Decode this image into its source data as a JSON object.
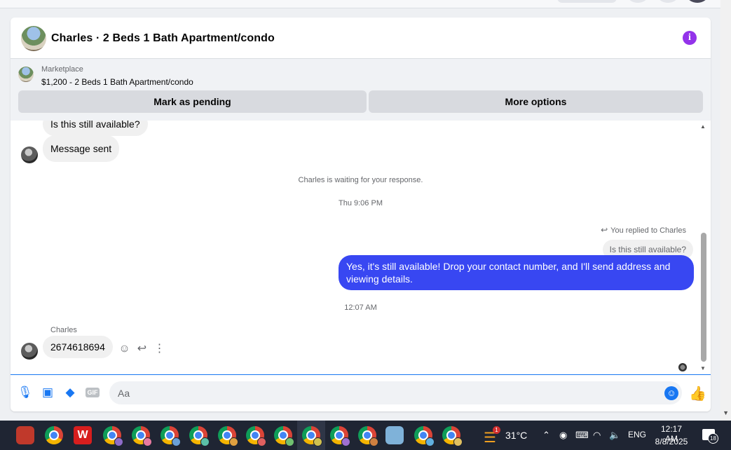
{
  "header": {
    "title": "Charles · 2 Beds 1 Bath Apartment/condo"
  },
  "marketplace": {
    "label": "Marketplace",
    "listing": "$1,200 - 2 Beds 1 Bath Apartment/condo",
    "mark_pending_label": "Mark as pending",
    "more_options_label": "More options"
  },
  "thread": {
    "msg_1": "Is this still available?",
    "msg_2": "Message sent",
    "waiting": "Charles is waiting for your response.",
    "time_1": "Thu 9:06 PM",
    "replied_to": "You replied to Charles",
    "quoted": "Is this still available?",
    "reply": "Yes, it's still available! Drop your contact number, and I'll send address and viewing details.",
    "time_2": "12:07 AM",
    "sender": "Charles",
    "msg_3": "2674618694"
  },
  "composer": {
    "placeholder": "Aa",
    "gif_label": "GIF"
  },
  "taskbar": {
    "temperature": "31°C",
    "weather_badge": "1",
    "language": "ENG",
    "time": "12:17 AM",
    "date": "8/8/2025",
    "notifications": "18"
  },
  "icons": {
    "info": "info-icon",
    "reply": "reply-icon",
    "emoji": "emoji-icon",
    "more": "more-vertical-icon",
    "mic": "microphone-icon",
    "photo": "photo-icon",
    "sticker": "sticker-icon",
    "like": "thumbs-up-icon"
  },
  "colors": {
    "accent": "#1877f2",
    "outgoing_bubble": "#3847f2",
    "info": "#9333ea"
  }
}
